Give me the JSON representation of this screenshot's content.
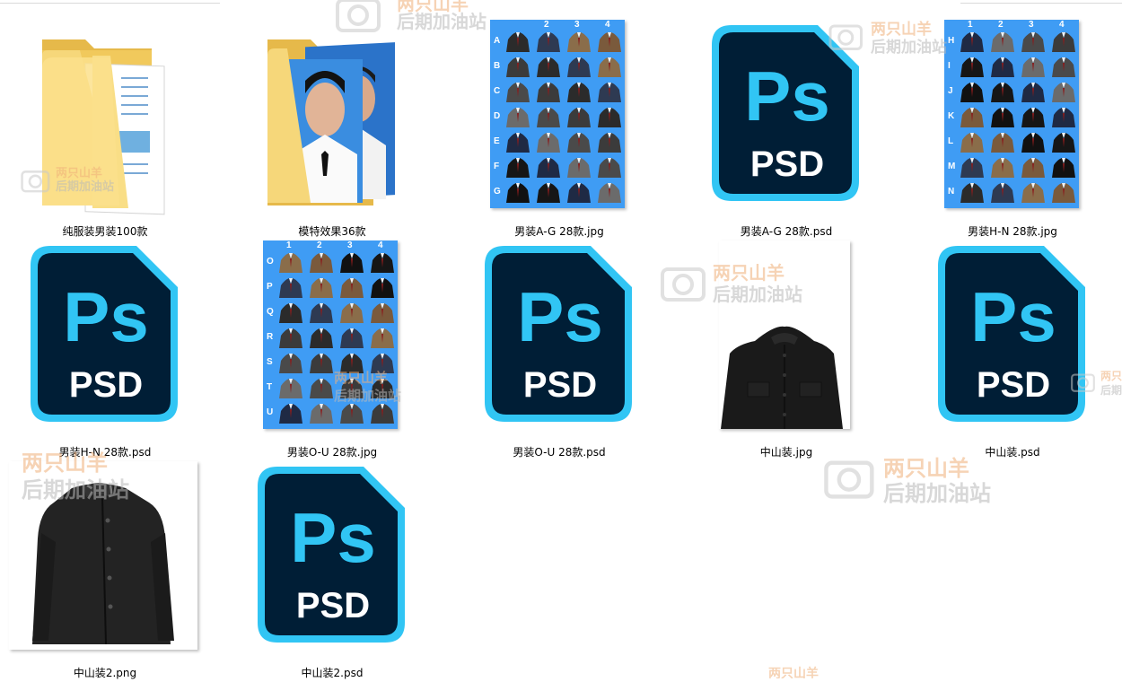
{
  "files": [
    {
      "name": "纯服装男装100款",
      "type": "folder-docs"
    },
    {
      "name": "模特效果36款",
      "type": "folder-photo"
    },
    {
      "name": "男装A-G  28款.jpg",
      "type": "sheet",
      "cols": [
        "2",
        "3",
        "4"
      ],
      "rows": [
        "A",
        "B",
        "C",
        "D",
        "E",
        "F",
        "G"
      ]
    },
    {
      "name": "男装A-G  28款.psd",
      "type": "psd"
    },
    {
      "name": "男装H-N  28款.jpg",
      "type": "sheet",
      "cols": [
        "1",
        "2",
        "3",
        "4"
      ],
      "rows": [
        "H",
        "I",
        "J",
        "K",
        "L",
        "M",
        "N"
      ]
    },
    {
      "name": "男装H-N  28款.psd",
      "type": "psd"
    },
    {
      "name": "男装O-U  28款.jpg",
      "type": "sheet",
      "cols": [
        "1",
        "2",
        "3",
        "4"
      ],
      "rows": [
        "O",
        "P",
        "Q",
        "R",
        "S",
        "T",
        "U"
      ]
    },
    {
      "name": "男装O-U 28款.psd",
      "type": "psd"
    },
    {
      "name": "中山装.jpg",
      "type": "photo-tunic"
    },
    {
      "name": "中山装.psd",
      "type": "psd"
    },
    {
      "name": "中山装2.png",
      "type": "photo-jacket"
    },
    {
      "name": "中山装2.psd",
      "type": "psd"
    }
  ],
  "psd_icon": {
    "logo": "Ps",
    "label": "PSD",
    "accent": "#31c5f4",
    "body": "#001e36"
  },
  "sheet_color": "#3f9cf4",
  "watermark": {
    "line1": "两只山羊",
    "line2": "后期加油站"
  }
}
